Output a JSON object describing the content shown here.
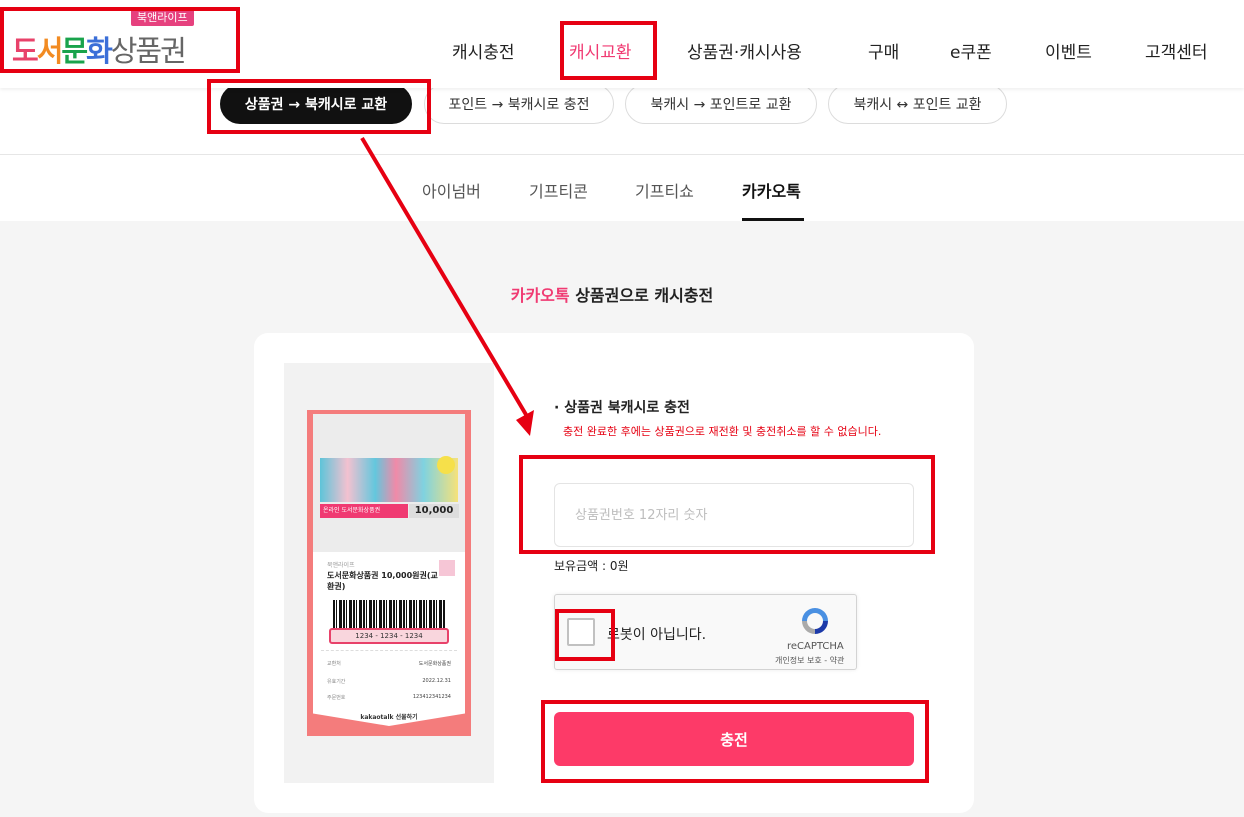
{
  "header": {
    "logo_badge": "북앤라이프",
    "logo_parts": [
      "도",
      "서",
      "문",
      "화",
      "상품권"
    ],
    "nav": [
      "캐시충전",
      "캐시교환",
      "상품권·캐시사용",
      "구매",
      "e쿠폰",
      "이벤트",
      "고객센터"
    ],
    "nav_active": "캐시교환"
  },
  "subnav": {
    "pills": [
      "상품권 → 북캐시로 교환",
      "포인트 → 북캐시로 충전",
      "북캐시 → 포인트로 교환",
      "북캐시 ↔ 포인트 교환"
    ],
    "active": "상품권 → 북캐시로 교환"
  },
  "tabs": {
    "items": [
      "아이넘버",
      "기프티콘",
      "기프티쇼",
      "카카오톡"
    ],
    "active": "카카오톡"
  },
  "section": {
    "title_accent": "카카오톡",
    "title_rest": " 상품권으로 캐시충전"
  },
  "voucher": {
    "strip": "온라인  도서문화상품권",
    "price": "10,000",
    "brand": "북앤라이프",
    "name": "도서문화상품권 10,000원권(교환권)",
    "code": "1234 - 1234 - 1234",
    "rows": [
      {
        "label": "교환처",
        "value": "도서문화상품권"
      },
      {
        "label": "유효기간",
        "value": "2022.12.31"
      },
      {
        "label": "주문번호",
        "value": "123412341234"
      }
    ],
    "kakao": "kakaotalk 선물하기"
  },
  "form": {
    "title": "· 상품권 북캐시로 충전",
    "warning": "충전 완료한 후에는 상품권으로 재전환 및 충전취소를 할 수 없습니다.",
    "input_placeholder": "상품권번호 12자리 숫자",
    "input_value": "",
    "balance": "보유금액 : 0원",
    "submit_label": "충전"
  },
  "recaptcha": {
    "label": "로봇이 아닙니다.",
    "brand": "reCAPTCHA",
    "links": "개인정보 보호 - 약관",
    "checked": false
  },
  "colors": {
    "accent": "#f03a72",
    "submit": "#fd3a68",
    "warning": "#e60012",
    "annotation": "#e60012"
  }
}
